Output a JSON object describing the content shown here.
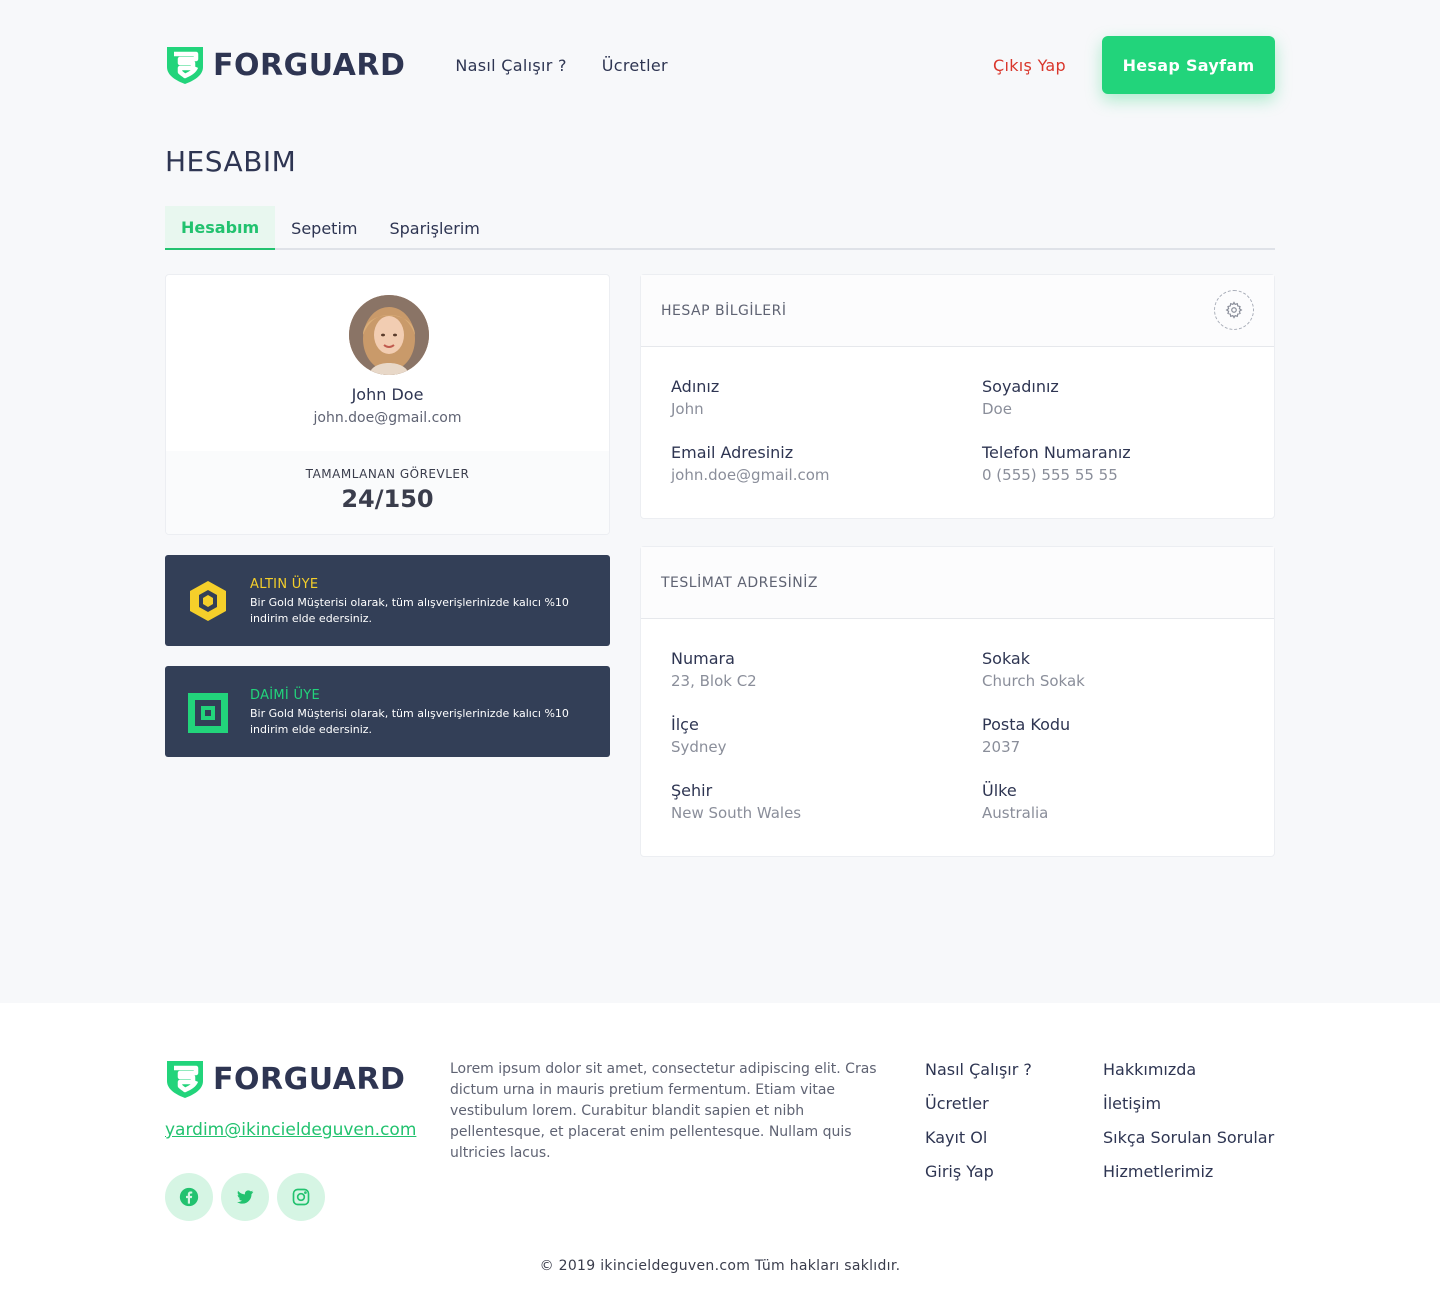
{
  "header": {
    "brand": "FORGUARD",
    "nav": [
      {
        "label": "Nasıl Çalışır ?"
      },
      {
        "label": "Ücretler"
      }
    ],
    "logout_label": "Çıkış Yap",
    "account_button": "Hesap Sayfam"
  },
  "page_title": "HESABIM",
  "tabs": [
    {
      "label": "Hesabım",
      "active": true
    },
    {
      "label": "Sepetim"
    },
    {
      "label": "Sparişlerim"
    }
  ],
  "profile": {
    "name": "John Doe",
    "email": "john.doe@gmail.com",
    "stats_label": "TAMAMLANAN GÖREVLER",
    "stats_value": "24/150"
  },
  "memberships": [
    {
      "title": "ALTIN ÜYE",
      "color": "#f5cf2a",
      "description": "Bir Gold Müşterisi olarak, tüm alışverişlerinizde kalıcı %10 indirim elde edersiniz.",
      "icon": "hexagon-badge-icon"
    },
    {
      "title": "DAİMİ ÜYE",
      "color": "#22d47b",
      "description": "Bir Gold Müşterisi olarak, tüm alışverişlerinizde kalıcı %10 indirim elde edersiniz.",
      "icon": "square-badge-icon"
    }
  ],
  "account_info": {
    "title": "HESAP BİLGİLERİ",
    "fields": [
      {
        "label": "Adınız",
        "value": "John"
      },
      {
        "label": "Soyadınız",
        "value": "Doe"
      },
      {
        "label": "Email Adresiniz",
        "value": "john.doe@gmail.com"
      },
      {
        "label": "Telefon Numaranız",
        "value": "0 (555) 555 55 55"
      }
    ]
  },
  "delivery": {
    "title": "TESLİMAT ADRESİNİZ",
    "fields": [
      {
        "label": "Numara",
        "value": "23, Blok C2"
      },
      {
        "label": "Sokak",
        "value": "Church Sokak"
      },
      {
        "label": "İlçe",
        "value": "Sydney"
      },
      {
        "label": "Posta Kodu",
        "value": "2037"
      },
      {
        "label": "Şehir",
        "value": "New South Wales"
      },
      {
        "label": "Ülke",
        "value": "Australia"
      }
    ]
  },
  "footer": {
    "brand": "FORGUARD",
    "email": "yardim@ikincieldeguven.com",
    "description": "Lorem ipsum dolor sit amet, consectetur adipiscing elit. Cras dictum urna in mauris pretium fermentum. Etiam vitae vestibulum lorem. Curabitur blandit sapien et nibh pellentesque, et placerat enim pellentesque. Nullam quis ultricies lacus.",
    "links_col1": [
      "Nasıl Çalışır ?",
      "Ücretler",
      "Kayıt Ol",
      "Giriş Yap"
    ],
    "links_col2": [
      "Hakkımızda",
      "İletişim",
      "Sıkça Sorulan Sorular",
      "Hizmetlerimiz"
    ],
    "socials": [
      "facebook-icon",
      "twitter-icon",
      "instagram-icon"
    ],
    "copyright": "© 2019 ikincieldeguven.com Tüm hakları saklıdır."
  },
  "colors": {
    "accent": "#22d47b",
    "dark_card": "#333f57",
    "logout": "#d9362b"
  }
}
